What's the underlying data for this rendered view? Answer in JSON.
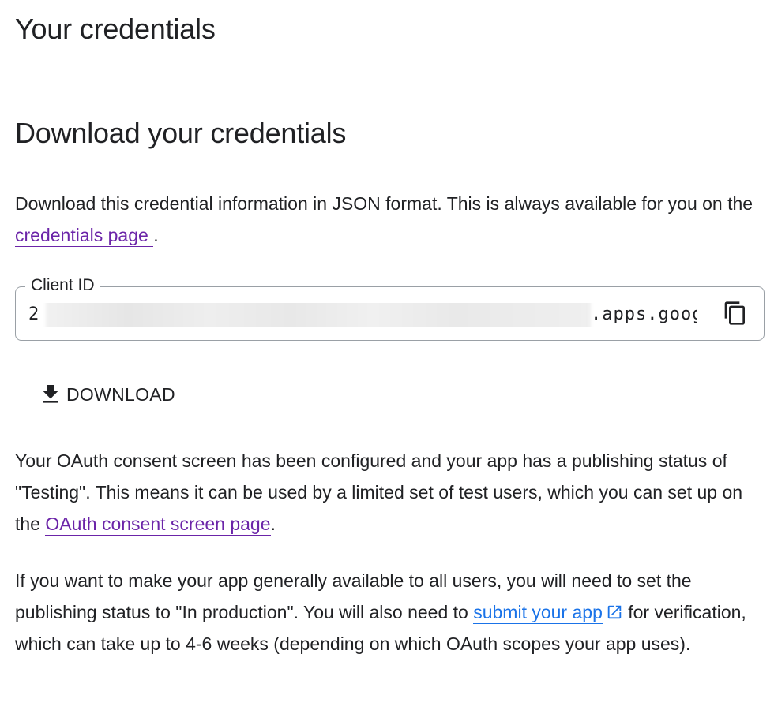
{
  "page": {
    "title": "Your credentials"
  },
  "download_section": {
    "title": "Download your credentials",
    "description_prefix": "Download this credential information in JSON format. This is always available for you on the ",
    "credentials_link": "credentials page ",
    "description_suffix": ".",
    "client_id": {
      "label": "Client ID",
      "value_visible_start": "2",
      "value_visible_end": ".apps.goog",
      "copy_icon": "copy-icon"
    },
    "download_button": {
      "label": "DOWNLOAD",
      "icon": "download-icon"
    }
  },
  "consent_info": {
    "text_prefix": "Your OAuth consent screen has been configured and your app has a publishing status of \"Testing\". This means it can be used by a limited set of test users, which you can set up on the ",
    "link_label": "OAuth consent screen page",
    "text_suffix": "."
  },
  "production_info": {
    "text_prefix": "If you want to make your app generally available to all users, you will need to set the publishing status to \"In production\". You will also need to ",
    "link_label": "submit your app",
    "link_icon": "external-link-icon",
    "text_suffix": " for verification, which can take up to 4-6 weeks (depending on which OAuth scopes your app uses)."
  },
  "colors": {
    "text": "#202124",
    "visited_link": "#6b24a8",
    "link": "#1a73e8",
    "border": "#9aa0a6"
  }
}
